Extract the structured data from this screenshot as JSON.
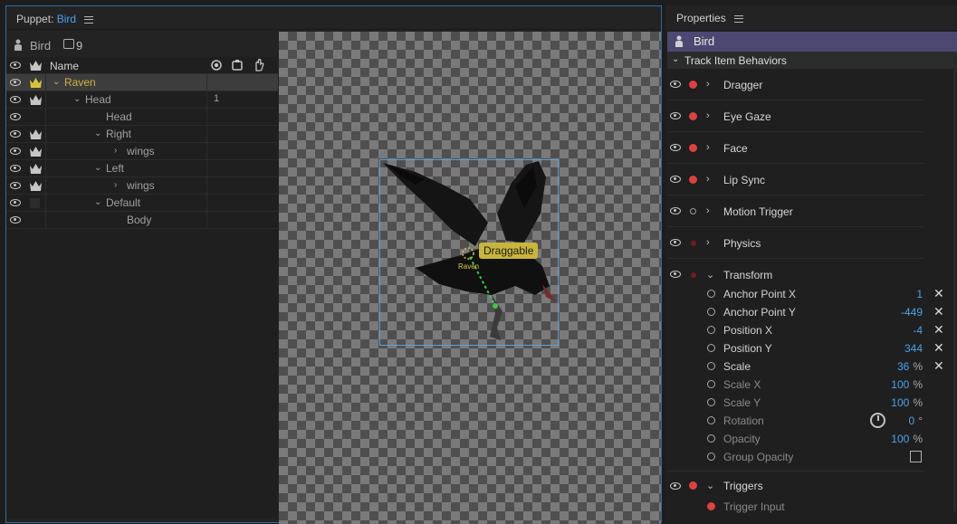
{
  "puppet_panel": {
    "tab_prefix": "Puppet: ",
    "tab_name": "Bird",
    "puppet_name": "Bird",
    "count": "9",
    "tree_header": {
      "name": "Name"
    },
    "rows": [
      {
        "label": "Raven",
        "num": "",
        "selected": true
      },
      {
        "label": "Head",
        "num": "1"
      },
      {
        "label": "Head",
        "num": ""
      },
      {
        "label": "Right",
        "num": ""
      },
      {
        "label": "wings",
        "num": ""
      },
      {
        "label": "Left",
        "num": ""
      },
      {
        "label": "wings",
        "num": ""
      },
      {
        "label": "Default",
        "num": ""
      },
      {
        "label": "Body",
        "num": ""
      }
    ],
    "viewport": {
      "draggable_label": "Draggable",
      "raven_label": "Raven"
    }
  },
  "properties_panel": {
    "title": "Properties",
    "puppet_name": "Bird",
    "section_title": "Track Item Behaviors",
    "behaviors": [
      {
        "label": "Dragger",
        "dot": "on"
      },
      {
        "label": "Eye Gaze",
        "dot": "on"
      },
      {
        "label": "Face",
        "dot": "on"
      },
      {
        "label": "Lip Sync",
        "dot": "on"
      },
      {
        "label": "Motion Trigger",
        "dot": "off"
      },
      {
        "label": "Physics",
        "dot": "dim"
      },
      {
        "label": "Transform",
        "dot": "dim"
      },
      {
        "label": "Triggers",
        "dot": "on"
      }
    ],
    "transform_params": [
      {
        "label": "Anchor Point X",
        "value": "1",
        "unit": ""
      },
      {
        "label": "Anchor Point Y",
        "value": "-449",
        "unit": ""
      },
      {
        "label": "Position X",
        "value": "-4",
        "unit": ""
      },
      {
        "label": "Position Y",
        "value": "344",
        "unit": ""
      },
      {
        "label": "Scale",
        "value": "36",
        "unit": "%"
      },
      {
        "label": "Scale X",
        "value": "100",
        "unit": "%"
      },
      {
        "label": "Scale Y",
        "value": "100",
        "unit": "%"
      },
      {
        "label": "Rotation",
        "value": "0",
        "unit": "°"
      },
      {
        "label": "Opacity",
        "value": "100",
        "unit": "%"
      },
      {
        "label": "Group Opacity",
        "value": "",
        "unit": ""
      }
    ],
    "trigger_input_label": "Trigger Input",
    "colors": {
      "accent": "#4aa2ea",
      "selected_bar": "#4c4872",
      "dot_on": "#e04040",
      "tree_selected_text": "#c9b640"
    }
  }
}
